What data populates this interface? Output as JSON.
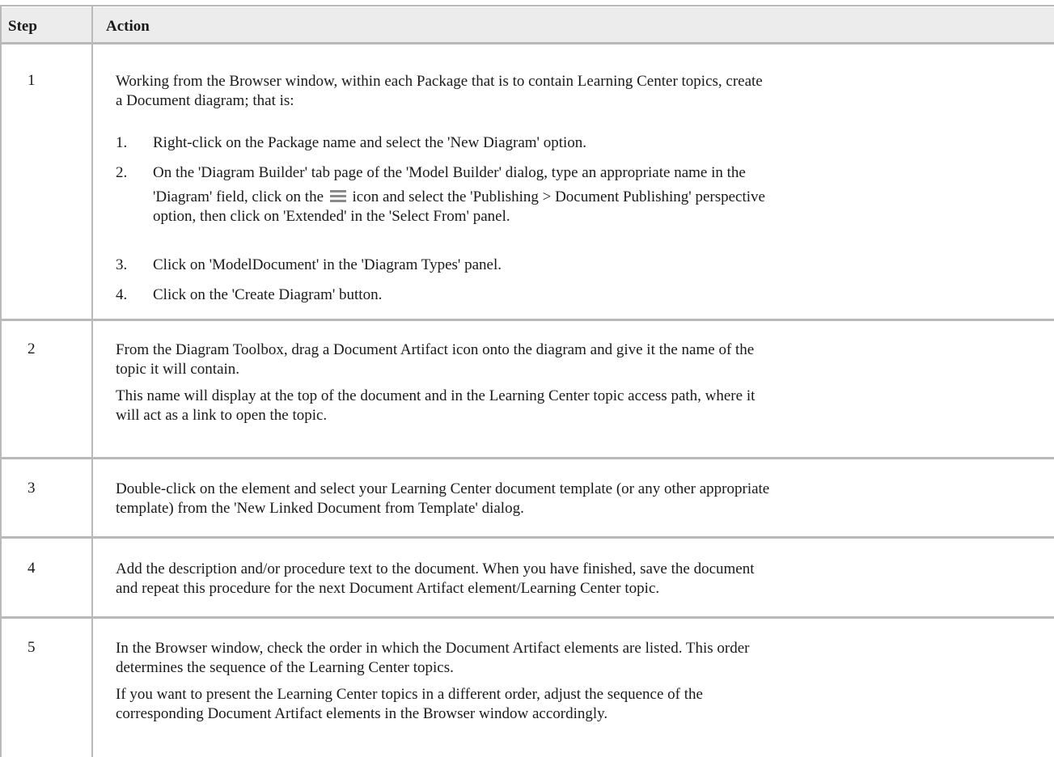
{
  "table": {
    "headers": {
      "step": "Step",
      "action": "Action"
    },
    "rows": [
      {
        "step": "1",
        "intro": [
          "Working from the Browser window, within each Package that is to contain Learning Center topics, create",
          "a Document diagram; that is:"
        ],
        "list": [
          {
            "n": "1.",
            "text": "Right-click on the Package name and select the 'New Diagram' option."
          },
          {
            "n": "2.",
            "l1": "On the 'Diagram Builder' tab page of the 'Model Builder' dialog, type an appropriate name in the",
            "l2a": "'Diagram' field, click on the",
            "l2b": "icon and select the 'Publishing > Document Publishing' perspective",
            "l3": "option, then click on 'Extended' in the 'Select From' panel."
          },
          {
            "n": "3.",
            "text": "Click on 'ModelDocument' in the 'Diagram Types' panel."
          },
          {
            "n": "4.",
            "text": "Click on the 'Create Diagram' button."
          }
        ]
      },
      {
        "step": "2",
        "p1": [
          "From the Diagram Toolbox, drag a Document Artifact icon onto the diagram and give it the name of the",
          "topic it will contain."
        ],
        "p2": [
          "This name will display at the top of the document and in the Learning Center topic access path, where it",
          "will act as a link to open the topic."
        ]
      },
      {
        "step": "3",
        "p1": [
          "Double-click on the element and select your Learning Center document template (or any other appropriate",
          "template) from the 'New Linked Document from Template' dialog."
        ]
      },
      {
        "step": "4",
        "p1": [
          "Add the description and/or procedure text to the document. When you have finished, save the document",
          "and repeat this procedure for the next Document Artifact element/Learning Center topic."
        ]
      },
      {
        "step": "5",
        "p1": [
          "In the Browser window, check the order in which the Document Artifact elements are listed. This order",
          "determines the sequence of the Learning Center topics."
        ],
        "p2": [
          "If you want to present the Learning Center topics in a different order, adjust the sequence of the",
          "corresponding Document Artifact elements in the Browser window accordingly."
        ]
      }
    ]
  },
  "icons": {
    "menu": "hamburger-menu-icon"
  }
}
